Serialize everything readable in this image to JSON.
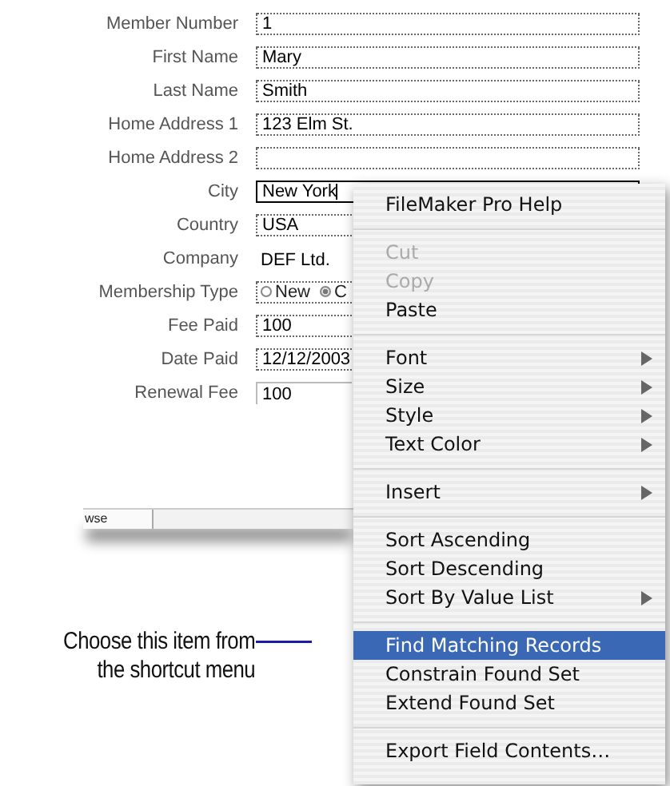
{
  "form": {
    "fields": [
      {
        "label": "Member Number",
        "kind": "field",
        "value": "1",
        "focused": false
      },
      {
        "label": "First Name",
        "kind": "field",
        "value": "Mary",
        "focused": false
      },
      {
        "label": "Last Name",
        "kind": "field",
        "value": "Smith",
        "focused": false
      },
      {
        "label": "Home Address 1",
        "kind": "field",
        "value": "123 Elm St.",
        "focused": false
      },
      {
        "label": "Home Address 2",
        "kind": "field",
        "focused": false
      },
      {
        "label": "City",
        "kind": "field",
        "value": "New York",
        "focused": true
      },
      {
        "label": "Country",
        "kind": "field",
        "value": "USA",
        "focused": false
      },
      {
        "label": "Company",
        "kind": "text",
        "value": "DEF Ltd."
      },
      {
        "label": "Membership Type",
        "kind": "radio",
        "options": [
          {
            "label": "New",
            "selected": false
          },
          {
            "label": "C",
            "selected": true
          }
        ]
      },
      {
        "label": "Fee Paid",
        "kind": "field",
        "value": "100",
        "focused": false
      },
      {
        "label": "Date Paid",
        "kind": "field",
        "value": "12/12/2003",
        "focused": false
      },
      {
        "label": "Renewal Fee",
        "kind": "calc",
        "value": "100"
      }
    ]
  },
  "status_bar": {
    "tab": "wse"
  },
  "callout": {
    "lines": [
      "Choose this item from",
      "the shortcut menu"
    ]
  },
  "context_menu": {
    "items": [
      {
        "kind": "item",
        "label": "FileMaker Pro Help",
        "disabled": false,
        "submenu": false,
        "selected": false
      },
      {
        "kind": "separator"
      },
      {
        "kind": "item",
        "label": "Cut",
        "disabled": true,
        "submenu": false,
        "selected": false
      },
      {
        "kind": "item",
        "label": "Copy",
        "disabled": true,
        "submenu": false,
        "selected": false
      },
      {
        "kind": "item",
        "label": "Paste",
        "disabled": false,
        "submenu": false,
        "selected": false
      },
      {
        "kind": "separator"
      },
      {
        "kind": "item",
        "label": "Font",
        "disabled": false,
        "submenu": true,
        "selected": false
      },
      {
        "kind": "item",
        "label": "Size",
        "disabled": false,
        "submenu": true,
        "selected": false
      },
      {
        "kind": "item",
        "label": "Style",
        "disabled": false,
        "submenu": true,
        "selected": false
      },
      {
        "kind": "item",
        "label": "Text Color",
        "disabled": false,
        "submenu": true,
        "selected": false
      },
      {
        "kind": "separator"
      },
      {
        "kind": "item",
        "label": "Insert",
        "disabled": false,
        "submenu": true,
        "selected": false
      },
      {
        "kind": "separator"
      },
      {
        "kind": "item",
        "label": "Sort Ascending",
        "disabled": false,
        "submenu": false,
        "selected": false
      },
      {
        "kind": "item",
        "label": "Sort Descending",
        "disabled": false,
        "submenu": false,
        "selected": false
      },
      {
        "kind": "item",
        "label": "Sort By Value List",
        "disabled": false,
        "submenu": true,
        "selected": false
      },
      {
        "kind": "separator"
      },
      {
        "kind": "item",
        "label": "Find Matching Records",
        "disabled": false,
        "submenu": false,
        "selected": true
      },
      {
        "kind": "item",
        "label": "Constrain Found Set",
        "disabled": false,
        "submenu": false,
        "selected": false
      },
      {
        "kind": "item",
        "label": "Extend Found Set",
        "disabled": false,
        "submenu": false,
        "selected": false
      },
      {
        "kind": "separator"
      },
      {
        "kind": "item",
        "label": "Export Field Contents…",
        "disabled": false,
        "submenu": false,
        "selected": false
      }
    ]
  }
}
